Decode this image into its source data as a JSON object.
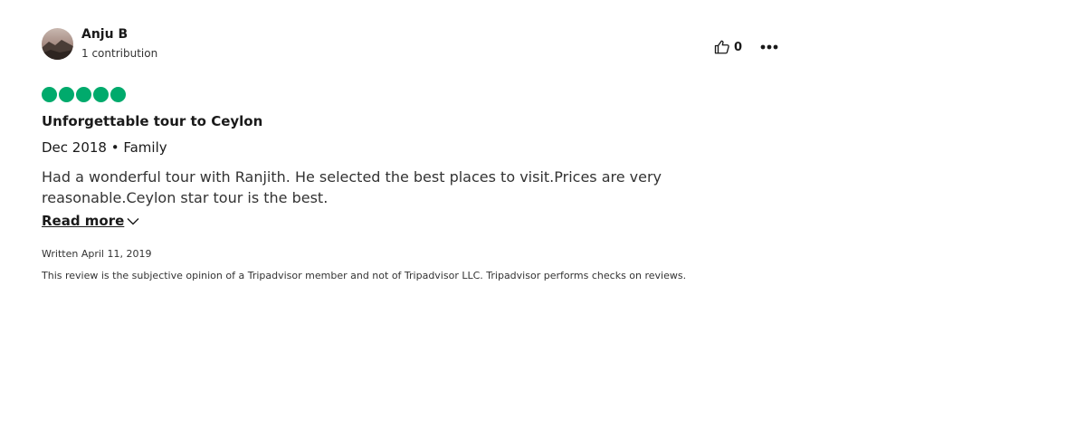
{
  "reviewer": {
    "name": "Anju B",
    "contributions": "1 contribution"
  },
  "actions": {
    "like_count": "0",
    "like_icon": "thumbs-up-icon",
    "more_icon": "ellipsis-icon"
  },
  "review": {
    "rating": 5,
    "rating_max": 5,
    "rating_color": "#00aa6c",
    "title": "Unforgettable tour to Ceylon",
    "meta": "Dec 2018 • Family",
    "text": "Had a wonderful tour with Ranjith. He selected the best places to visit.Prices are very reasonable.Ceylon star tour is the best.",
    "read_more_label": "Read more",
    "written_date": "Written April 11, 2019",
    "disclaimer": "This review is the subjective opinion of a Tripadvisor member and not of Tripadvisor LLC. Tripadvisor performs checks on reviews."
  }
}
